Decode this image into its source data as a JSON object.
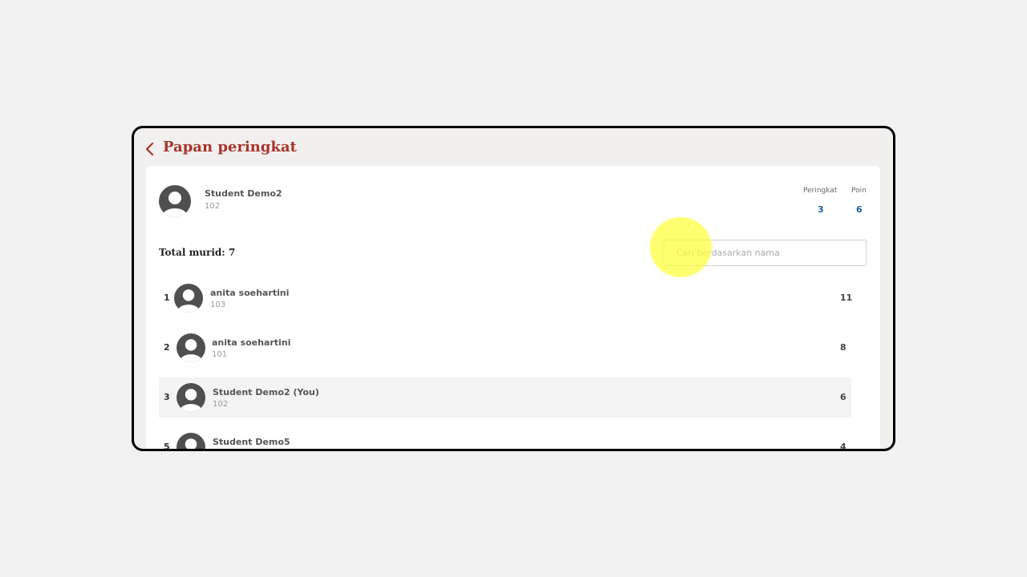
{
  "header": {
    "title": "Papan peringkat",
    "back_icon": "chevron-left-icon"
  },
  "colors": {
    "accent": "#a8342a",
    "stat": "#1b5e9a",
    "highlight_row": "#f3f3f3"
  },
  "me": {
    "name": "Student Demo2",
    "id": "102",
    "rank_label": "Peringkat",
    "rank": "3",
    "points_label": "Poin",
    "points": "6"
  },
  "total_label": "Total murid: 7",
  "search": {
    "placeholder": "Cari berdasarkan nama",
    "value": ""
  },
  "leaderboard": [
    {
      "rank": "1",
      "name": "anita soehartini",
      "id": "103",
      "points": "11",
      "highlighted": false
    },
    {
      "rank": "2",
      "name": "anita soehartini",
      "id": "101",
      "points": "8",
      "highlighted": false
    },
    {
      "rank": "3",
      "name": "Student Demo2 (You)",
      "id": "102",
      "points": "6",
      "highlighted": true
    },
    {
      "rank": "5",
      "name": "Student Demo5",
      "id": "",
      "points": "4",
      "highlighted": false
    }
  ]
}
